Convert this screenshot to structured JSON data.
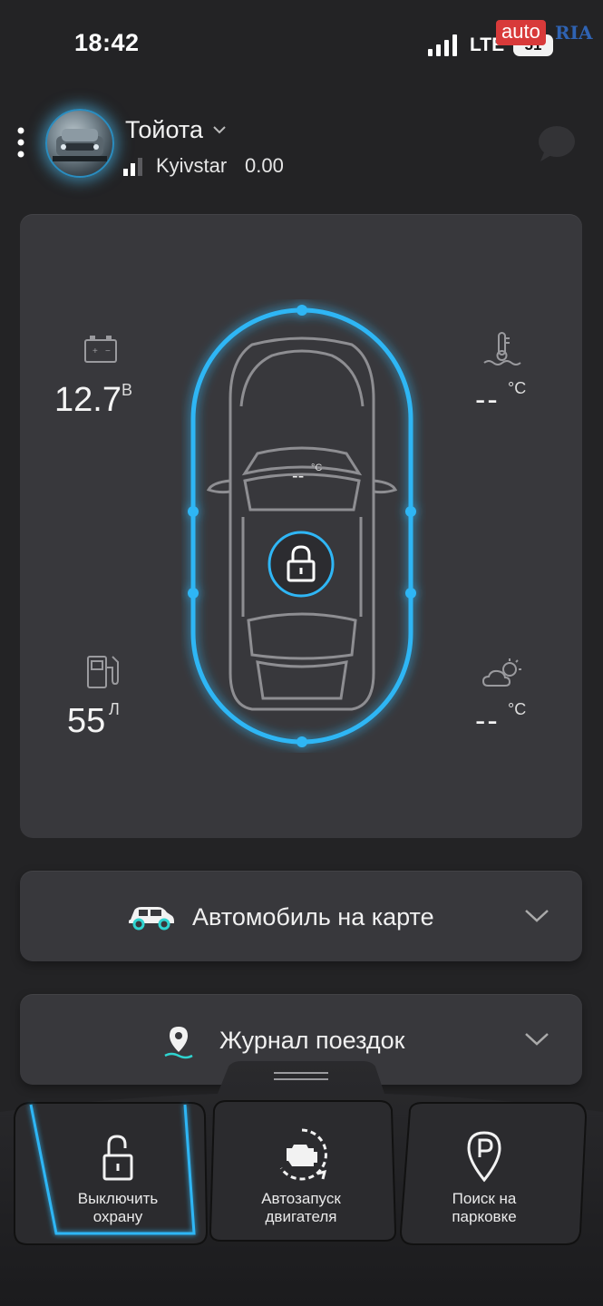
{
  "status_bar": {
    "time": "18:42",
    "network": "LTE",
    "battery": "51",
    "watermark_auto": "auto",
    "watermark_ria": "RIA"
  },
  "header": {
    "car_name": "Тойота",
    "operator": "Kyivstar",
    "balance": "0.00"
  },
  "status": {
    "battery_voltage": "12.7",
    "battery_unit": "В",
    "fuel": "55",
    "fuel_unit": "Л",
    "engine_temp": "--",
    "engine_temp_unit": "°C",
    "cabin_temp": "--",
    "cabin_temp_unit": "°C",
    "outside_temp": "--",
    "outside_temp_unit": "°C",
    "lock_state": "locked"
  },
  "sections": {
    "map": "Автомобиль на карте",
    "trips": "Журнал поездок"
  },
  "controls": {
    "disarm_line1": "Выключить",
    "disarm_line2": "охрану",
    "autostart_line1": "Автозапуск",
    "autostart_line2": "двигателя",
    "parking_line1": "Поиск на",
    "parking_line2": "парковке"
  },
  "colors": {
    "accent": "#2fb6f5",
    "background": "#232325",
    "card": "#38383c"
  }
}
